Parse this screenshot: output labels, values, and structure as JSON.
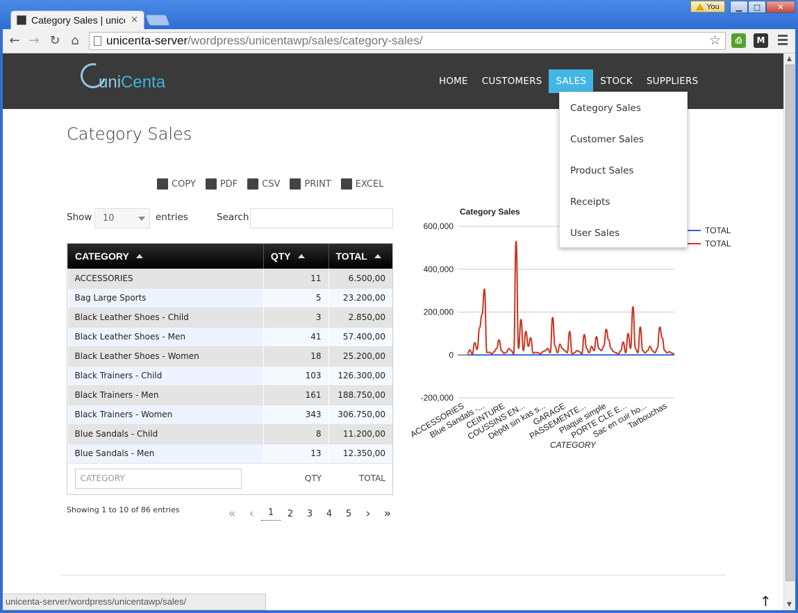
{
  "browser": {
    "tab_title": "Category Sales | unicenta",
    "tab_close": "×",
    "user_badge": "You",
    "win_min": "▁",
    "win_max": "□",
    "win_close": "✕",
    "url_host": "unicenta-server",
    "url_path": "/wordpress/unicentawp/sales/category-sales/",
    "status_url": "unicenta-server/wordpress/unicentawp/sales/"
  },
  "site": {
    "logo_uni": "uni",
    "logo_centa": "Centa",
    "nav": [
      {
        "label": "HOME",
        "active": false
      },
      {
        "label": "CUSTOMERS",
        "active": false
      },
      {
        "label": "SALES",
        "active": true
      },
      {
        "label": "STOCK",
        "active": false
      },
      {
        "label": "SUPPLIERS",
        "active": false
      }
    ],
    "sales_menu": [
      "Category Sales",
      "Customer Sales",
      "Product Sales",
      "Receipts",
      "User Sales"
    ]
  },
  "page": {
    "title": "Category Sales",
    "export_buttons": [
      "COPY",
      "PDF",
      "CSV",
      "PRINT",
      "EXCEL"
    ],
    "show_label": "Show",
    "length_value": "10",
    "entries_label": "entries",
    "search_label": "Search:",
    "search_value": "",
    "table": {
      "columns": [
        "CATEGORY",
        "QTY",
        "TOTAL"
      ],
      "rows": [
        [
          "ACCESSORIES",
          "11",
          "6.500,00"
        ],
        [
          "Bag Large Sports",
          "5",
          "23.200,00"
        ],
        [
          "Black Leather Shoes - Child",
          "3",
          "2.850,00"
        ],
        [
          "Black Leather Shoes - Men",
          "41",
          "57.400,00"
        ],
        [
          "Black Leather Shoes - Women",
          "18",
          "25.200,00"
        ],
        [
          "Black Trainers - Child",
          "103",
          "126.300,00"
        ],
        [
          "Black Trainers - Men",
          "161",
          "188.750,00"
        ],
        [
          "Black Trainers - Women",
          "343",
          "306.750,00"
        ],
        [
          "Blue Sandals - Child",
          "8",
          "11.200,00"
        ],
        [
          "Blue Sandals - Men",
          "13",
          "12.350,00"
        ]
      ],
      "footer_filter_placeholder": "CATEGORY",
      "footer_qty": "QTY",
      "footer_total": "TOTAL"
    },
    "info": "Showing 1 to 10 of 86 entries",
    "pager": {
      "first": "«",
      "prev": "‹",
      "pages": [
        "1",
        "2",
        "3",
        "4",
        "5"
      ],
      "current": "1",
      "next": "›",
      "last": "»"
    },
    "back_to_top": "↑"
  },
  "chart_data": {
    "type": "line",
    "title": "Category Sales",
    "xlabel": "CATEGORY",
    "ylabel": "",
    "ylim": [
      -200000,
      600000
    ],
    "yticks": [
      "600,000",
      "400,000",
      "200,000",
      "0",
      "-200,000"
    ],
    "x_tick_labels": [
      "ACCESSORIES",
      "Blue Sandals -...",
      "CEINTURE",
      "COUSSINS EN...",
      "Dépôt sin kas s...",
      "GARAGE",
      "PASSEMENTE...",
      "Plaque simple",
      "PORTE CLE E...",
      "Sac en cuir ho...",
      "Tarbouchas"
    ],
    "legend": [
      "TOTAL",
      "TOTAL"
    ],
    "legend_position": "right",
    "colors": [
      "#3366cc",
      "#cc3322"
    ],
    "series": [
      {
        "name": "TOTAL",
        "values": [
          0,
          0,
          0,
          0,
          0,
          0,
          0,
          0,
          0,
          0,
          0,
          0,
          0,
          0,
          0,
          0,
          0,
          0,
          0,
          0,
          0,
          0,
          0,
          0,
          0,
          0,
          0,
          0,
          0,
          0,
          0,
          0,
          0,
          0,
          0,
          0,
          0,
          0,
          0,
          0,
          0,
          0,
          0,
          0,
          0,
          0,
          0,
          0,
          0,
          0,
          0,
          0,
          0,
          0,
          0,
          0,
          0,
          0,
          0,
          0,
          0,
          0,
          0,
          0,
          0,
          0,
          0,
          0,
          0,
          0,
          0,
          0,
          0,
          0,
          0,
          0,
          0,
          0,
          0,
          0,
          0,
          0,
          0,
          0,
          0,
          0
        ]
      },
      {
        "name": "TOTAL",
        "values": [
          6500,
          23200,
          2850,
          57400,
          25200,
          126300,
          188750,
          306750,
          11200,
          12350,
          5000,
          15000,
          30000,
          70000,
          20000,
          8000,
          12000,
          30000,
          20000,
          5000,
          530000,
          30000,
          165000,
          20000,
          110000,
          40000,
          80000,
          8000,
          12000,
          10000,
          5000,
          15000,
          20000,
          30000,
          10000,
          175000,
          40000,
          10000,
          50000,
          30000,
          20000,
          10000,
          110000,
          5000,
          10000,
          20000,
          15000,
          5000,
          95000,
          30000,
          10000,
          40000,
          20000,
          85000,
          30000,
          20000,
          40000,
          120000,
          70000,
          30000,
          15000,
          10000,
          5000,
          20000,
          60000,
          10000,
          100000,
          30000,
          225000,
          30000,
          10000,
          130000,
          20000,
          10000,
          20000,
          40000,
          20000,
          10000,
          30000,
          130000,
          80000,
          20000,
          10000,
          15000,
          8000,
          5000
        ]
      }
    ]
  }
}
